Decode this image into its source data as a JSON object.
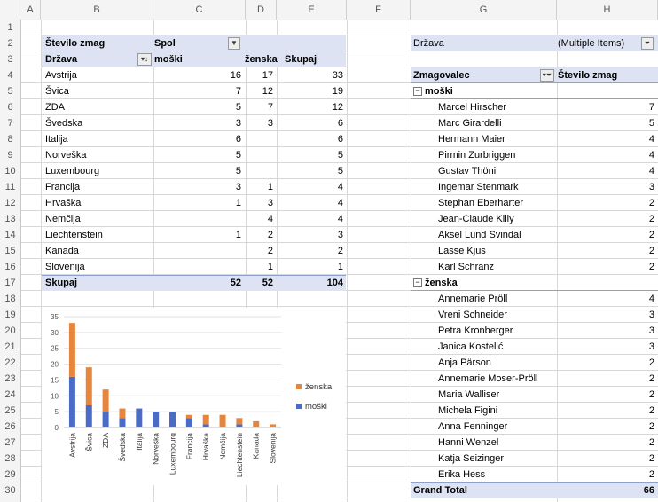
{
  "columns": [
    "A",
    "B",
    "C",
    "D",
    "E",
    "F",
    "G",
    "H"
  ],
  "rows": [
    "1",
    "2",
    "3",
    "4",
    "5",
    "6",
    "7",
    "8",
    "9",
    "10",
    "11",
    "12",
    "13",
    "14",
    "15",
    "16",
    "17",
    "18",
    "19",
    "20",
    "21",
    "22",
    "23",
    "24",
    "25",
    "26",
    "27",
    "28",
    "29",
    "30"
  ],
  "left_pivot": {
    "value_header": "Število zmag",
    "column_field": "Spol",
    "row_field": "Država",
    "col_labels": [
      "moški",
      "ženska",
      "Skupaj"
    ],
    "rows": [
      {
        "country": "Avstrija",
        "m": "16",
        "z": "17",
        "t": "33"
      },
      {
        "country": "Švica",
        "m": "7",
        "z": "12",
        "t": "19"
      },
      {
        "country": "ZDA",
        "m": "5",
        "z": "7",
        "t": "12"
      },
      {
        "country": "Švedska",
        "m": "3",
        "z": "3",
        "t": "6"
      },
      {
        "country": "Italija",
        "m": "6",
        "z": "",
        "t": "6"
      },
      {
        "country": "Norveška",
        "m": "5",
        "z": "",
        "t": "5"
      },
      {
        "country": "Luxembourg",
        "m": "5",
        "z": "",
        "t": "5"
      },
      {
        "country": "Francija",
        "m": "3",
        "z": "1",
        "t": "4"
      },
      {
        "country": "Hrvaška",
        "m": "1",
        "z": "3",
        "t": "4"
      },
      {
        "country": "Nemčija",
        "m": "",
        "z": "4",
        "t": "4"
      },
      {
        "country": "Liechtenstein",
        "m": "1",
        "z": "2",
        "t": "3"
      },
      {
        "country": "Kanada",
        "m": "",
        "z": "2",
        "t": "2"
      },
      {
        "country": "Slovenija",
        "m": "",
        "z": "1",
        "t": "1"
      }
    ],
    "total": {
      "label": "Skupaj",
      "m": "52",
      "z": "52",
      "t": "104"
    }
  },
  "right_pivot": {
    "filter_label": "Država",
    "filter_value": "(Multiple Items)",
    "row_header": "Zmagovalec",
    "value_header": "Število zmag",
    "groups": [
      {
        "name": "moški",
        "items": [
          {
            "name": "Marcel Hirscher",
            "value": "7"
          },
          {
            "name": "Marc Girardelli",
            "value": "5"
          },
          {
            "name": "Hermann Maier",
            "value": "4"
          },
          {
            "name": "Pirmin Zurbriggen",
            "value": "4"
          },
          {
            "name": "Gustav Thöni",
            "value": "4"
          },
          {
            "name": "Ingemar Stenmark",
            "value": "3"
          },
          {
            "name": "Stephan Eberharter",
            "value": "2"
          },
          {
            "name": "Jean-Claude Killy",
            "value": "2"
          },
          {
            "name": "Aksel Lund Svindal",
            "value": "2"
          },
          {
            "name": "Lasse Kjus",
            "value": "2"
          },
          {
            "name": "Karl Schranz",
            "value": "2"
          }
        ]
      },
      {
        "name": "ženska",
        "items": [
          {
            "name": "Annemarie Pröll",
            "value": "4"
          },
          {
            "name": "Vreni Schneider",
            "value": "3"
          },
          {
            "name": "Petra Kronberger",
            "value": "3"
          },
          {
            "name": "Janica Kostelić",
            "value": "3"
          },
          {
            "name": "Anja Pärson",
            "value": "2"
          },
          {
            "name": "Annemarie Moser-Pröll",
            "value": "2"
          },
          {
            "name": "Maria Walliser",
            "value": "2"
          },
          {
            "name": "Michela Figini",
            "value": "2"
          },
          {
            "name": "Anna Fenninger",
            "value": "2"
          },
          {
            "name": "Hanni Wenzel",
            "value": "2"
          },
          {
            "name": "Katja Seizinger",
            "value": "2"
          },
          {
            "name": "Erika Hess",
            "value": "2"
          }
        ]
      }
    ],
    "grand_total_label": "Grand Total",
    "grand_total_value": "66"
  },
  "colors": {
    "moski": "#4a6cc6",
    "zenska": "#e6863e",
    "header_band": "#dde3f2"
  },
  "chart_data": {
    "type": "bar",
    "stacked": true,
    "categories": [
      "Avstrija",
      "Švica",
      "ZDA",
      "Švedska",
      "Italija",
      "Norveška",
      "Luxembourg",
      "Francija",
      "Hrvaška",
      "Nemčija",
      "Liechtenstein",
      "Kanada",
      "Slovenija"
    ],
    "series": [
      {
        "name": "moški",
        "values": [
          16,
          7,
          5,
          3,
          6,
          5,
          5,
          3,
          1,
          0,
          1,
          0,
          0
        ]
      },
      {
        "name": "ženska",
        "values": [
          17,
          12,
          7,
          3,
          0,
          0,
          0,
          1,
          3,
          4,
          2,
          2,
          1
        ]
      }
    ],
    "ylim": [
      0,
      35
    ],
    "yticks": [
      "0",
      "5",
      "10",
      "15",
      "20",
      "25",
      "30",
      "35"
    ],
    "legend": "right"
  }
}
